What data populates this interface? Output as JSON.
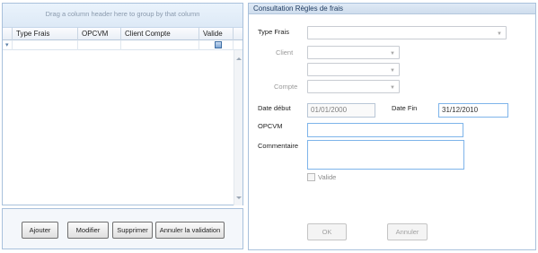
{
  "grid": {
    "group_hint": "Drag a column header here to group by that column",
    "columns": [
      "Type Frais",
      "OPCVM",
      "Client Compte",
      "Valide"
    ]
  },
  "buttons": {
    "ajouter": "Ajouter",
    "modifier": "Modifier",
    "supprimer": "Supprimer",
    "annuler_validation": "Annuler la validation"
  },
  "form": {
    "title": "Consultation Règles de frais",
    "type_frais_label": "Type Frais",
    "client_label": "Client",
    "compte_label": "Compte",
    "date_debut_label": "Date début",
    "date_debut_value": "01/01/2000",
    "date_fin_label": "Date Fin",
    "date_fin_value": "31/12/2010",
    "opcvm_label": "OPCVM",
    "commentaire_label": "Commentaire",
    "valide_label": "Valide",
    "ok_label": "OK",
    "annuler_label": "Annuler"
  }
}
